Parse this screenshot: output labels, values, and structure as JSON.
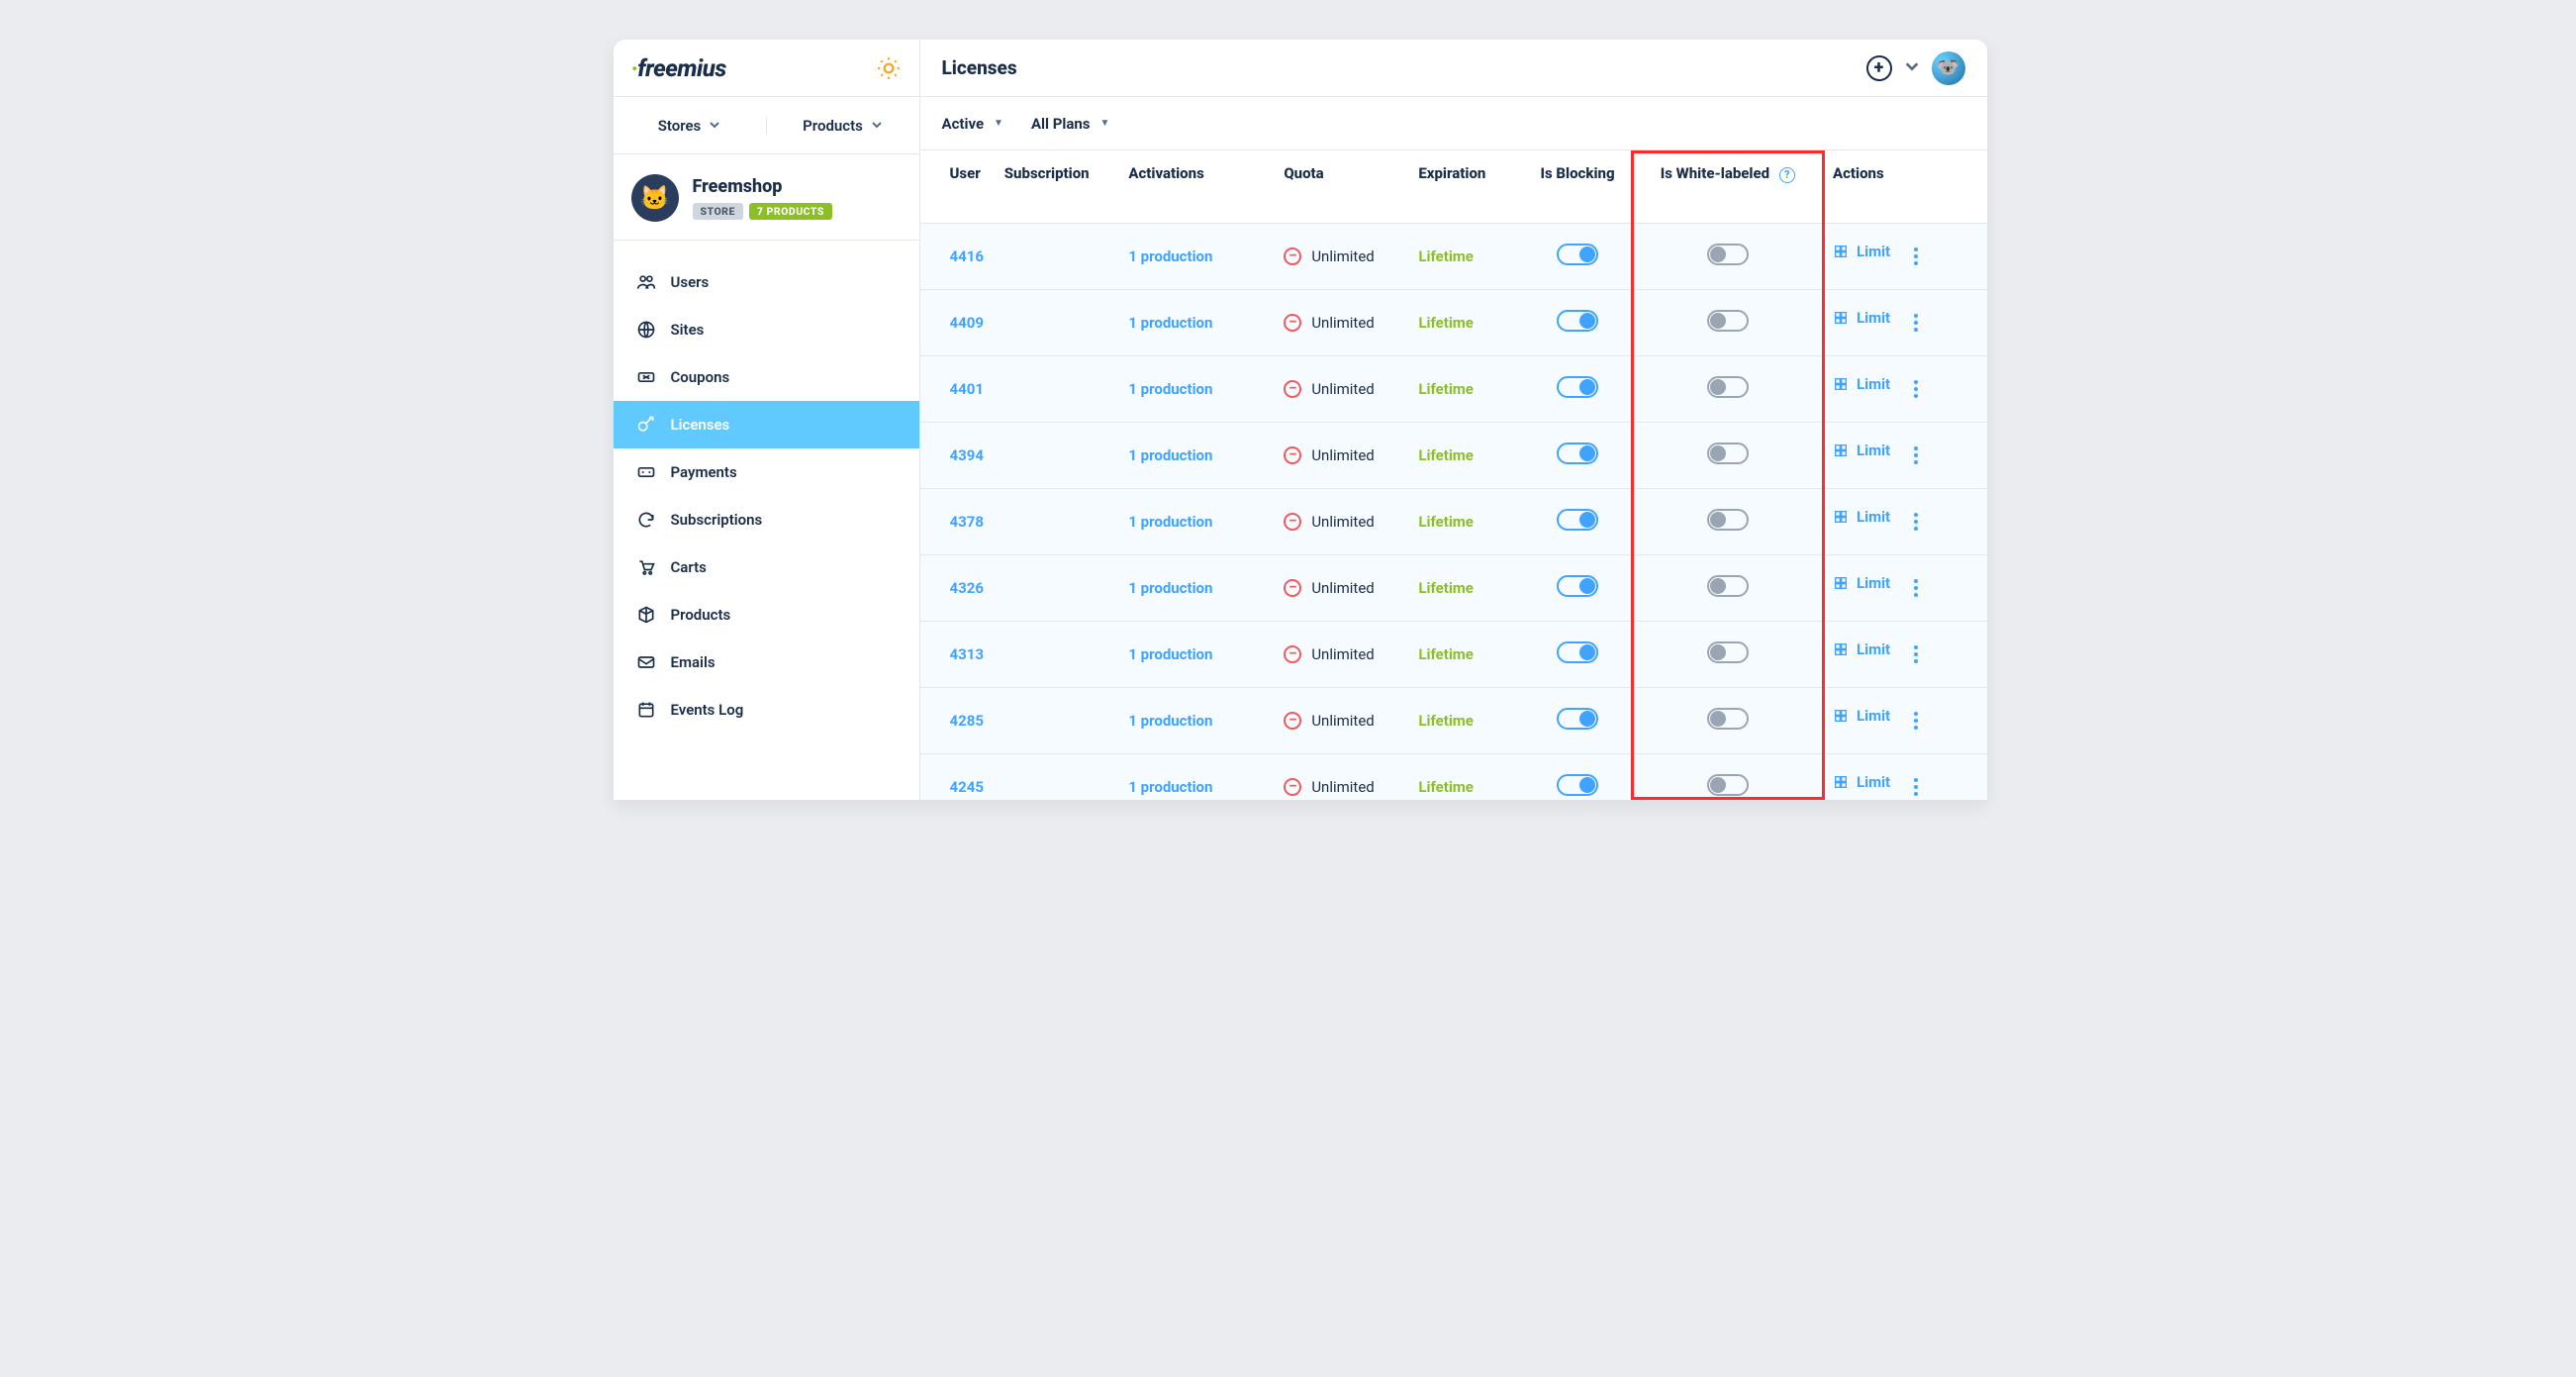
{
  "brand": "freemius",
  "page_title": "Licenses",
  "top_selectors": {
    "stores": "Stores",
    "products": "Products"
  },
  "store": {
    "name": "Freemshop",
    "badge_store": "STORE",
    "badge_products": "7 PRODUCTS"
  },
  "nav": [
    {
      "key": "users",
      "label": "Users"
    },
    {
      "key": "sites",
      "label": "Sites"
    },
    {
      "key": "coupons",
      "label": "Coupons"
    },
    {
      "key": "licenses",
      "label": "Licenses",
      "active": true
    },
    {
      "key": "payments",
      "label": "Payments"
    },
    {
      "key": "subscriptions",
      "label": "Subscriptions"
    },
    {
      "key": "carts",
      "label": "Carts"
    },
    {
      "key": "products",
      "label": "Products"
    },
    {
      "key": "emails",
      "label": "Emails"
    },
    {
      "key": "events",
      "label": "Events Log"
    }
  ],
  "filters": {
    "status": "Active",
    "plan": "All Plans"
  },
  "columns": {
    "user": "User",
    "subscription": "Subscription",
    "activations": "Activations",
    "quota": "Quota",
    "expiration": "Expiration",
    "is_blocking": "Is Blocking",
    "is_white_labeled": "Is White-labeled",
    "actions": "Actions"
  },
  "row_common": {
    "activations": "1 production",
    "quota": "Unlimited",
    "expiration": "Lifetime",
    "limit_label": "Limit"
  },
  "rows": [
    {
      "user": "4416",
      "blocking": true,
      "white_labeled": false
    },
    {
      "user": "4409",
      "blocking": true,
      "white_labeled": false
    },
    {
      "user": "4401",
      "blocking": true,
      "white_labeled": false
    },
    {
      "user": "4394",
      "blocking": true,
      "white_labeled": false
    },
    {
      "user": "4378",
      "blocking": true,
      "white_labeled": false
    },
    {
      "user": "4326",
      "blocking": true,
      "white_labeled": false
    },
    {
      "user": "4313",
      "blocking": true,
      "white_labeled": false
    },
    {
      "user": "4285",
      "blocking": true,
      "white_labeled": false
    },
    {
      "user": "4245",
      "blocking": true,
      "white_labeled": false
    }
  ]
}
